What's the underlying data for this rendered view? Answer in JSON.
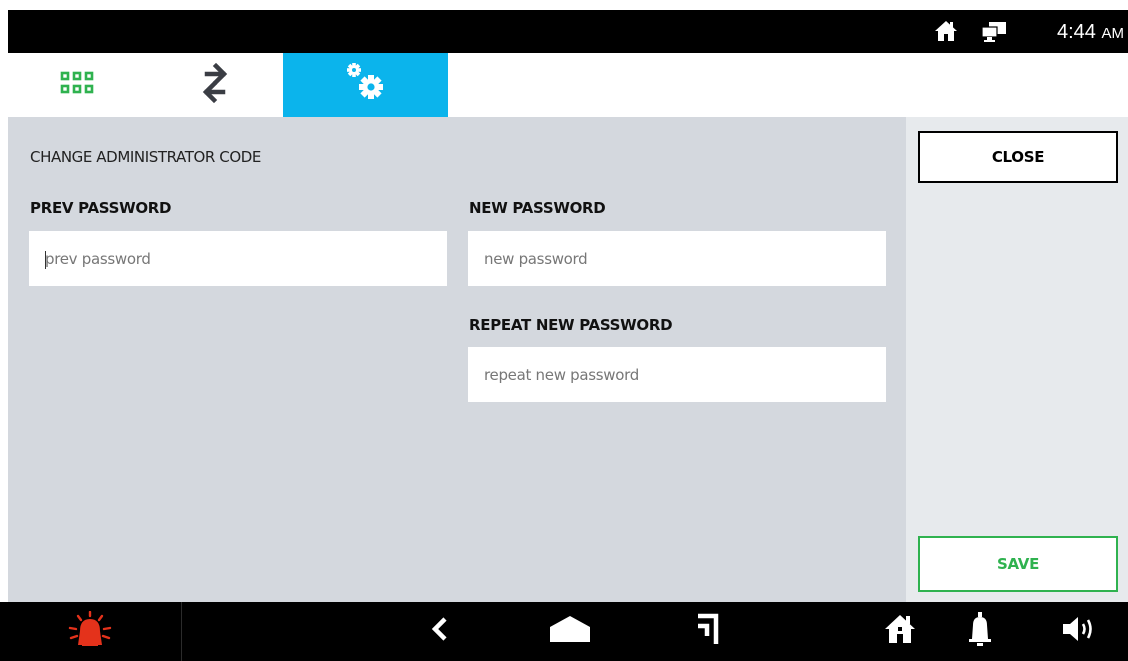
{
  "status_bar": {
    "time": "4:44",
    "ampm": "AM",
    "icons": [
      "home-icon",
      "screen-icon"
    ]
  },
  "tabs": [
    {
      "icon": "apps-grid-icon",
      "selected": false
    },
    {
      "icon": "transfer-arrows-icon",
      "selected": false
    },
    {
      "icon": "settings-gears-icon",
      "selected": true
    }
  ],
  "form": {
    "title": "CHANGE ADMINISTRATOR CODE",
    "prev_label": "PREV PASSWORD",
    "prev_placeholder": "prev password",
    "new_label": "NEW PASSWORD",
    "new_placeholder": "new password",
    "repeat_label": "REPEAT NEW PASSWORD",
    "repeat_placeholder": "repeat new password"
  },
  "actions": {
    "close": "CLOSE",
    "save": "SAVE"
  },
  "bottom_nav": {
    "icons": [
      "alarm-icon",
      "back-icon",
      "home-icon",
      "recent-icon",
      "house-icon",
      "bell-icon",
      "volume-icon"
    ]
  },
  "colors": {
    "accent": "#0bb4ec",
    "grid_icon": "#2fb24f",
    "save": "#2fb24f",
    "alarm": "#e4321b",
    "panel_bg": "#d4d8de",
    "side_bg": "#e7eaed"
  }
}
